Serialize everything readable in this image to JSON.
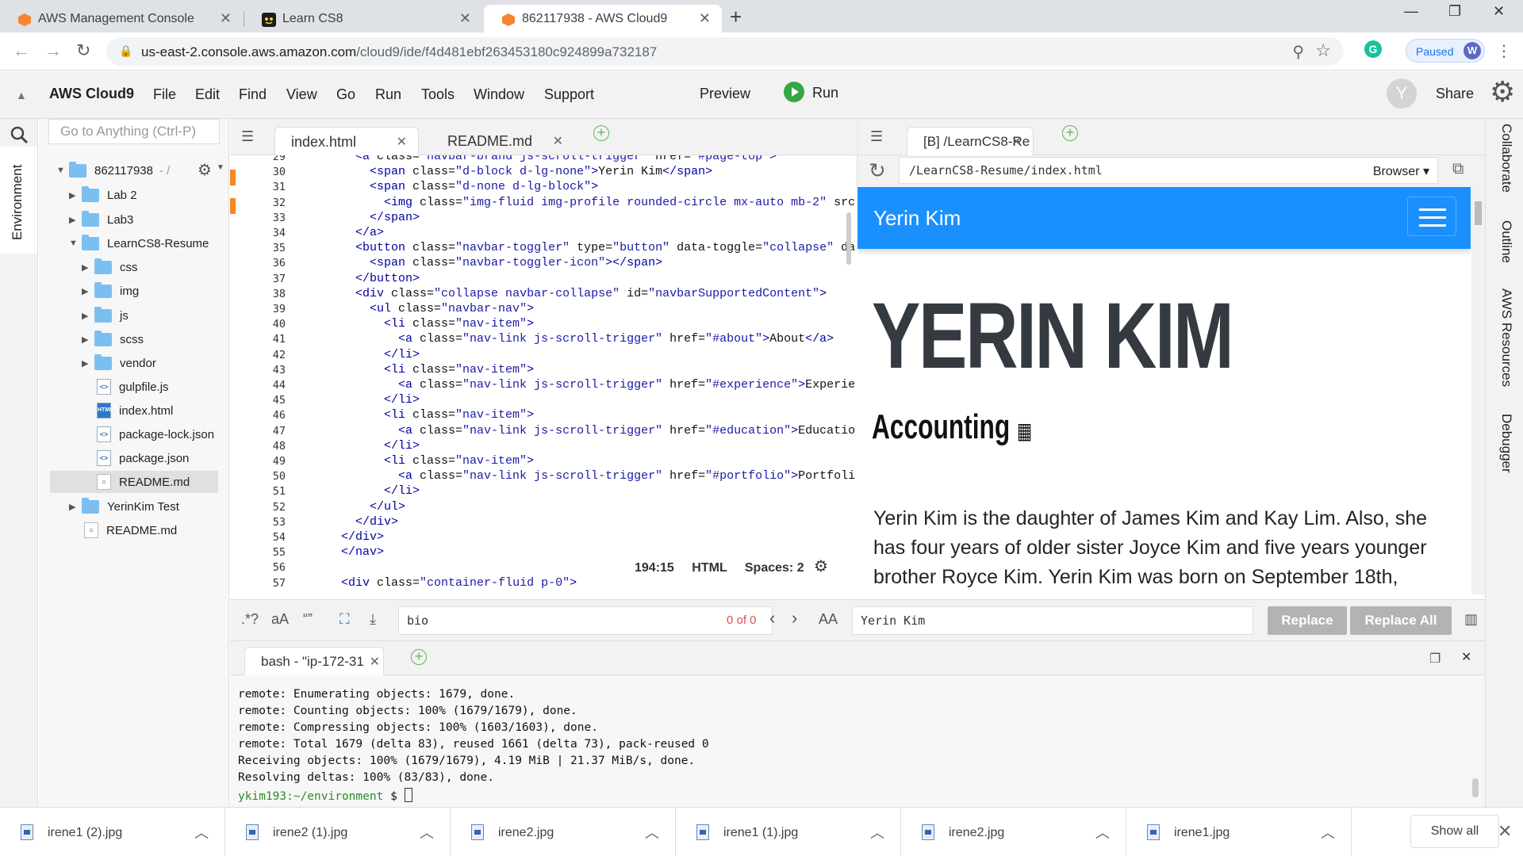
{
  "chrome": {
    "tabs": [
      {
        "title": "AWS Management Console"
      },
      {
        "title": "Learn CS8"
      },
      {
        "title": "862117938 - AWS Cloud9"
      }
    ],
    "new_tab": "+",
    "window_controls": {
      "minimize": "—",
      "maximize": "❐",
      "close": "✕"
    },
    "url_host": "us-east-2.console.aws.amazon.com",
    "url_path": "/cloud9/ide/f4d481ebf263453180c924899a732187",
    "profile_status": "Paused",
    "profile_initial": "W",
    "extension_initial": "G"
  },
  "c9": {
    "brand": "AWS Cloud9",
    "menu": [
      "File",
      "Edit",
      "Find",
      "View",
      "Go",
      "Run",
      "Tools",
      "Window",
      "Support"
    ],
    "preview": "Preview",
    "run": "Run",
    "avatar_initial": "Y",
    "share": "Share"
  },
  "left_panel": {
    "environment_tab": "Environment"
  },
  "tree": {
    "search_placeholder": "Go to Anything (Ctrl-P)",
    "root": "862117938",
    "root_suffix": "- /",
    "items": [
      {
        "label": "Lab 2",
        "type": "folder"
      },
      {
        "label": "Lab3",
        "type": "folder"
      },
      {
        "label": "LearnCS8-Resume",
        "type": "folder",
        "expanded": true
      },
      {
        "label": "css",
        "type": "folder"
      },
      {
        "label": "img",
        "type": "folder"
      },
      {
        "label": "js",
        "type": "folder"
      },
      {
        "label": "scss",
        "type": "folder"
      },
      {
        "label": "vendor",
        "type": "folder"
      },
      {
        "label": "gulpfile.js",
        "type": "file"
      },
      {
        "label": "index.html",
        "type": "file"
      },
      {
        "label": "package-lock.json",
        "type": "file"
      },
      {
        "label": "package.json",
        "type": "file"
      },
      {
        "label": "README.md",
        "type": "file"
      },
      {
        "label": "YerinKim Test",
        "type": "folder"
      },
      {
        "label": "README.md",
        "type": "file"
      }
    ]
  },
  "editor": {
    "tabs": [
      {
        "label": "index.html"
      },
      {
        "label": "README.md"
      }
    ],
    "lines": [
      {
        "n": "29",
        "text": "    <a class=\"navbar-brand js-scroll-trigger\" href=\"#page-top\">"
      },
      {
        "n": "30",
        "text": "      <span class=\"d-block d-lg-none\">Yerin Kim</span>"
      },
      {
        "n": "31",
        "text": "      <span class=\"d-none d-lg-block\">"
      },
      {
        "n": "32",
        "text": "        <img class=\"img-fluid img-profile rounded-circle mx-auto mb-2\" src="
      },
      {
        "n": "33",
        "text": "      </span>"
      },
      {
        "n": "34",
        "text": "    </a>"
      },
      {
        "n": "35",
        "text": "    <button class=\"navbar-toggler\" type=\"button\" data-toggle=\"collapse\" dat"
      },
      {
        "n": "36",
        "text": "      <span class=\"navbar-toggler-icon\"></span>"
      },
      {
        "n": "37",
        "text": "    </button>"
      },
      {
        "n": "38",
        "text": "    <div class=\"collapse navbar-collapse\" id=\"navbarSupportedContent\">"
      },
      {
        "n": "39",
        "text": "      <ul class=\"navbar-nav\">"
      },
      {
        "n": "40",
        "text": "        <li class=\"nav-item\">"
      },
      {
        "n": "41",
        "text": "          <a class=\"nav-link js-scroll-trigger\" href=\"#about\">About</a>"
      },
      {
        "n": "42",
        "text": "        </li>"
      },
      {
        "n": "43",
        "text": "        <li class=\"nav-item\">"
      },
      {
        "n": "44",
        "text": "          <a class=\"nav-link js-scroll-trigger\" href=\"#experience\">Experien"
      },
      {
        "n": "45",
        "text": "        </li>"
      },
      {
        "n": "46",
        "text": "        <li class=\"nav-item\">"
      },
      {
        "n": "47",
        "text": "          <a class=\"nav-link js-scroll-trigger\" href=\"#education\">Education"
      },
      {
        "n": "48",
        "text": "        </li>"
      },
      {
        "n": "49",
        "text": "        <li class=\"nav-item\">"
      },
      {
        "n": "50",
        "text": "          <a class=\"nav-link js-scroll-trigger\" href=\"#portfolio\">Portfolio"
      },
      {
        "n": "51",
        "text": "        </li>"
      },
      {
        "n": "52",
        "text": "      </ul>"
      },
      {
        "n": "53",
        "text": "    </div>"
      },
      {
        "n": "54",
        "text": "  </div>"
      },
      {
        "n": "55",
        "text": "  </nav>"
      },
      {
        "n": "56",
        "text": ""
      },
      {
        "n": "57",
        "text": "  <div class=\"container-fluid p-0\">"
      }
    ],
    "cursor_pos": "194:15",
    "language": "HTML",
    "spaces": "Spaces: 2"
  },
  "preview_pane": {
    "tab": "[B] /LearnCS8-Re",
    "url": "/LearnCS8-Resume/index.html",
    "browser_select": "Browser ▾",
    "nav_brand": "Yerin Kim",
    "heading": "YERIN KIM",
    "subheading": "Accounting",
    "bio": "Yerin Kim is the daughter of James Kim and Kay Lim. Also, she has four years of older sister Joyce Kim and five years younger brother Royce Kim. Yerin Kim was born on September 18th,"
  },
  "right_panel": [
    "Collaborate",
    "Outline",
    "AWS Resources",
    "Debugger"
  ],
  "find": {
    "regex": ".*?",
    "case": "aA",
    "word": "“”",
    "find_value": "bio",
    "count": "0 of 0",
    "preserve_case": "AA",
    "replace_value": "Yerin Kim",
    "replace": "Replace",
    "replace_all": "Replace All"
  },
  "terminal": {
    "tab": "bash - \"ip-172-31",
    "lines": [
      "remote: Enumerating objects: 1679, done.",
      "remote: Counting objects: 100% (1679/1679), done.",
      "remote: Compressing objects: 100% (1603/1603), done.",
      "remote: Total 1679 (delta 83), reused 1661 (delta 73), pack-reused 0",
      "Receiving objects: 100% (1679/1679), 4.19 MiB | 21.37 MiB/s, done.",
      "Resolving deltas: 100% (83/83), done."
    ],
    "prompt": "ykim193:~/environment",
    "prompt_symbol": "$"
  },
  "downloads": {
    "items": [
      "irene1 (2).jpg",
      "irene2 (1).jpg",
      "irene2.jpg",
      "irene1 (1).jpg",
      "irene2.jpg",
      "irene1.jpg"
    ],
    "show_all": "Show all"
  },
  "colors": {
    "accent": "#1a90ff",
    "run_green": "#35a741",
    "folder": "#7bbff0"
  }
}
